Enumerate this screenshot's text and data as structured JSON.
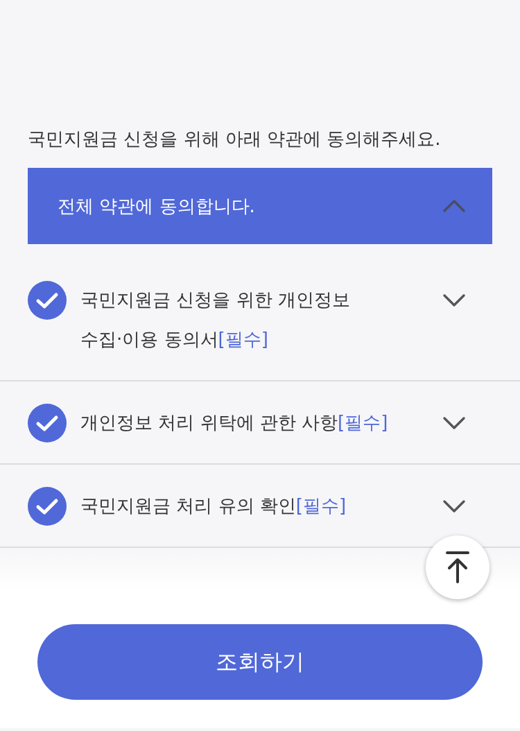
{
  "intro": "국민지원금 신청을 위해 아래 약관에 동의해주세요.",
  "agree_all": {
    "label": "전체 약관에 동의합니다.",
    "checked": true,
    "expanded": true
  },
  "terms": [
    {
      "title": "국민지원금 신청을 위한 개인정보 수집·이용 동의서",
      "tag": "[필수]",
      "checked": true,
      "expanded": false
    },
    {
      "title": "개인정보 처리 위탁에 관한 사항",
      "tag": "[필수]",
      "checked": true,
      "expanded": false
    },
    {
      "title": "국민지원금 처리 유의 확인",
      "tag": "[필수]",
      "checked": true,
      "expanded": false
    }
  ],
  "submit_button": "조회하기"
}
